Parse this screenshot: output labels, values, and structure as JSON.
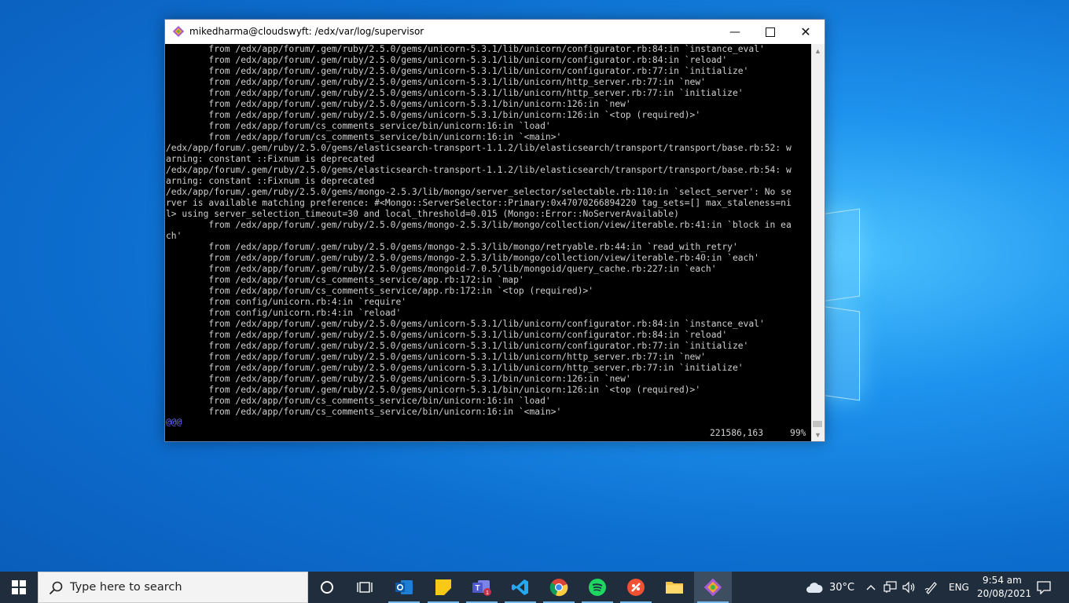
{
  "window": {
    "title": "mikedharma@cloudswyft: /edx/var/log/supervisor",
    "minimize_glyph": "—",
    "close_glyph": "✕"
  },
  "terminal": {
    "lines": [
      "        from /edx/app/forum/.gem/ruby/2.5.0/gems/unicorn-5.3.1/lib/unicorn/configurator.rb:84:in `instance_eval'",
      "        from /edx/app/forum/.gem/ruby/2.5.0/gems/unicorn-5.3.1/lib/unicorn/configurator.rb:84:in `reload'",
      "        from /edx/app/forum/.gem/ruby/2.5.0/gems/unicorn-5.3.1/lib/unicorn/configurator.rb:77:in `initialize'",
      "        from /edx/app/forum/.gem/ruby/2.5.0/gems/unicorn-5.3.1/lib/unicorn/http_server.rb:77:in `new'",
      "        from /edx/app/forum/.gem/ruby/2.5.0/gems/unicorn-5.3.1/lib/unicorn/http_server.rb:77:in `initialize'",
      "        from /edx/app/forum/.gem/ruby/2.5.0/gems/unicorn-5.3.1/bin/unicorn:126:in `new'",
      "        from /edx/app/forum/.gem/ruby/2.5.0/gems/unicorn-5.3.1/bin/unicorn:126:in `<top (required)>'",
      "        from /edx/app/forum/cs_comments_service/bin/unicorn:16:in `load'",
      "        from /edx/app/forum/cs_comments_service/bin/unicorn:16:in `<main>'",
      "/edx/app/forum/.gem/ruby/2.5.0/gems/elasticsearch-transport-1.1.2/lib/elasticsearch/transport/transport/base.rb:52: w",
      "arning: constant ::Fixnum is deprecated",
      "/edx/app/forum/.gem/ruby/2.5.0/gems/elasticsearch-transport-1.1.2/lib/elasticsearch/transport/transport/base.rb:54: w",
      "arning: constant ::Fixnum is deprecated",
      "/edx/app/forum/.gem/ruby/2.5.0/gems/mongo-2.5.3/lib/mongo/server_selector/selectable.rb:110:in `select_server': No se",
      "rver is available matching preference: #<Mongo::ServerSelector::Primary:0x47070266894220 tag_sets=[] max_staleness=ni",
      "l> using server_selection_timeout=30 and local_threshold=0.015 (Mongo::Error::NoServerAvailable)",
      "        from /edx/app/forum/.gem/ruby/2.5.0/gems/mongo-2.5.3/lib/mongo/collection/view/iterable.rb:41:in `block in ea",
      "ch'",
      "        from /edx/app/forum/.gem/ruby/2.5.0/gems/mongo-2.5.3/lib/mongo/retryable.rb:44:in `read_with_retry'",
      "        from /edx/app/forum/.gem/ruby/2.5.0/gems/mongo-2.5.3/lib/mongo/collection/view/iterable.rb:40:in `each'",
      "        from /edx/app/forum/.gem/ruby/2.5.0/gems/mongoid-7.0.5/lib/mongoid/query_cache.rb:227:in `each'",
      "        from /edx/app/forum/cs_comments_service/app.rb:172:in `map'",
      "        from /edx/app/forum/cs_comments_service/app.rb:172:in `<top (required)>'",
      "        from config/unicorn.rb:4:in `require'",
      "        from config/unicorn.rb:4:in `reload'",
      "        from /edx/app/forum/.gem/ruby/2.5.0/gems/unicorn-5.3.1/lib/unicorn/configurator.rb:84:in `instance_eval'",
      "        from /edx/app/forum/.gem/ruby/2.5.0/gems/unicorn-5.3.1/lib/unicorn/configurator.rb:84:in `reload'",
      "        from /edx/app/forum/.gem/ruby/2.5.0/gems/unicorn-5.3.1/lib/unicorn/configurator.rb:77:in `initialize'",
      "        from /edx/app/forum/.gem/ruby/2.5.0/gems/unicorn-5.3.1/lib/unicorn/http_server.rb:77:in `new'",
      "        from /edx/app/forum/.gem/ruby/2.5.0/gems/unicorn-5.3.1/lib/unicorn/http_server.rb:77:in `initialize'",
      "        from /edx/app/forum/.gem/ruby/2.5.0/gems/unicorn-5.3.1/bin/unicorn:126:in `new'",
      "        from /edx/app/forum/.gem/ruby/2.5.0/gems/unicorn-5.3.1/bin/unicorn:126:in `<top (required)>'",
      "        from /edx/app/forum/cs_comments_service/bin/unicorn:16:in `load'",
      "        from /edx/app/forum/cs_comments_service/bin/unicorn:16:in `<main>'"
    ],
    "vim_marker": "@@@",
    "status_position": "221586,163",
    "status_percent": "99%"
  },
  "taskbar": {
    "search_placeholder": "Type here to search",
    "apps": [
      "task-view",
      "outlook",
      "sticky-notes",
      "teams",
      "vscode",
      "chrome",
      "spotify",
      "git",
      "file-explorer",
      "git-bash"
    ],
    "teams_badge": "1",
    "weather": "30°C",
    "language": "ENG",
    "time": "9:54 am",
    "date": "20/08/2021"
  },
  "colors": {
    "desktop": "#1e93ee",
    "taskbar": "#1f2d3d",
    "terminal_bg": "#000000",
    "terminal_fg": "#d0d0d0"
  }
}
